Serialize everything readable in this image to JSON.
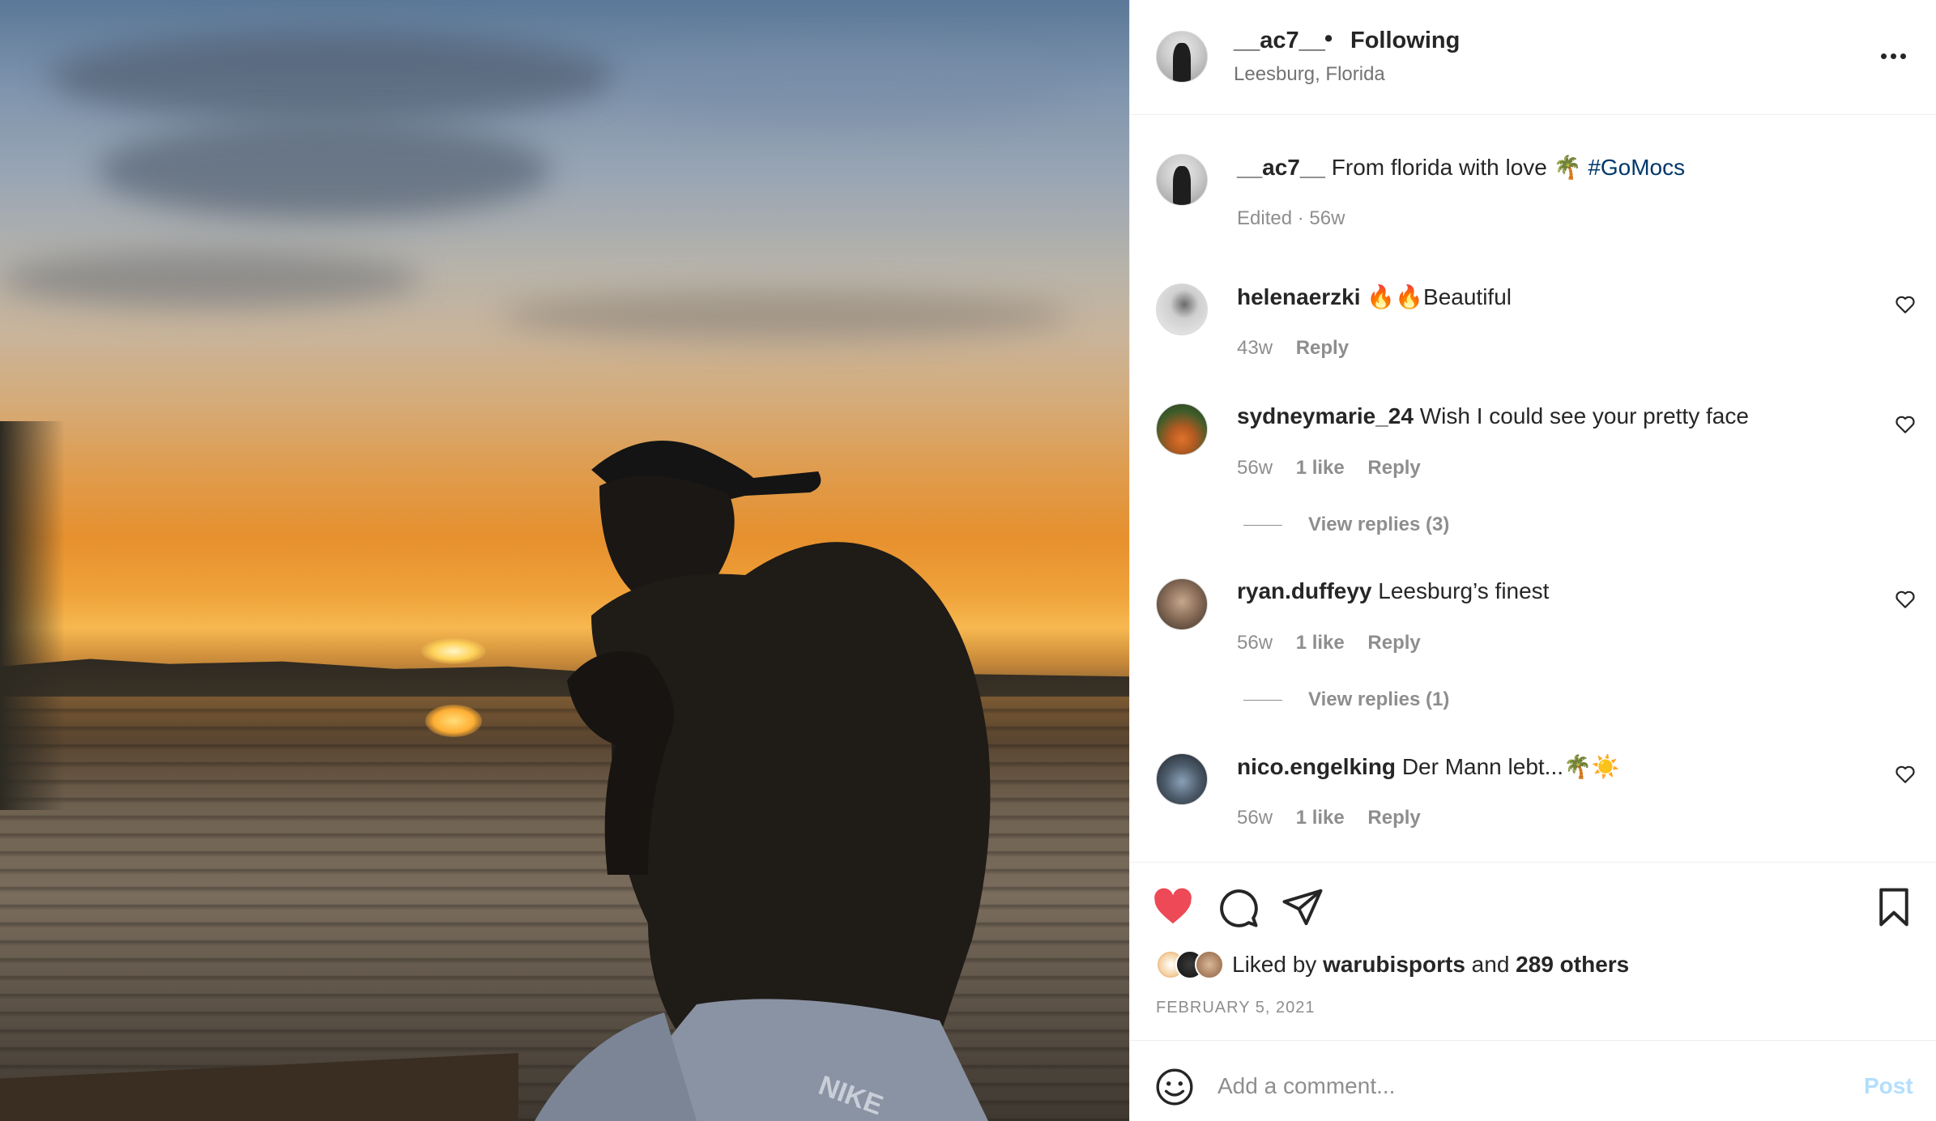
{
  "post": {
    "username": "__ac7__",
    "separator": "•",
    "follow_status": "Following",
    "location": "Leesburg, Florida"
  },
  "caption": {
    "username": "__ac7__",
    "text": "From florida with love 🌴",
    "hashtag": "#GoMocs",
    "edited": "Edited",
    "time": "56w"
  },
  "comments": [
    {
      "username": "helenaerzki",
      "text": "🔥🔥Beautiful",
      "time": "43w",
      "likes": "",
      "reply": "Reply"
    },
    {
      "username": "sydneymarie_24",
      "text": "Wish I could see your pretty face",
      "time": "56w",
      "likes": "1 like",
      "reply": "Reply",
      "view_replies": "View replies (3)"
    },
    {
      "username": "ryan.duffeyy",
      "text": "Leesburg’s finest",
      "time": "56w",
      "likes": "1 like",
      "reply": "Reply",
      "view_replies": "View replies (1)"
    },
    {
      "username": "nico.engelking",
      "text": "Der Mann lebt...🌴☀️",
      "time": "56w",
      "likes": "1 like",
      "reply": "Reply"
    }
  ],
  "likes": {
    "prefix": "Liked by",
    "user": "warubisports",
    "and": "and",
    "others": "289 others"
  },
  "date": "FEBRUARY 5, 2021",
  "add_comment": {
    "placeholder": "Add a comment...",
    "post_label": "Post"
  },
  "colors": {
    "liked_heart": "#ed4956",
    "hashtag": "#00376b",
    "post_disabled": "#b2dffc",
    "secondary_text": "#8e8e8e"
  },
  "icons": [
    "heart-filled-icon",
    "comment-icon",
    "share-icon",
    "bookmark-icon",
    "more-icon",
    "emoji-icon",
    "heart-outline-icon"
  ]
}
